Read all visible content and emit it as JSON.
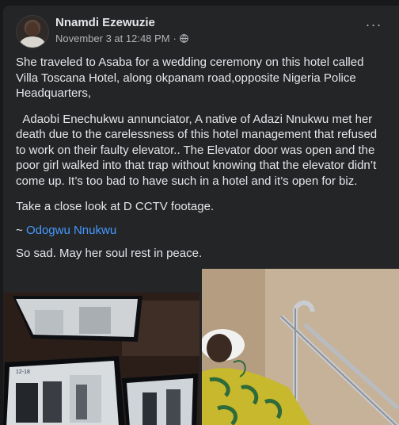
{
  "post": {
    "author": "Nnamdi Ezewuzie",
    "timestamp": "November 3 at 12:48 PM",
    "separator": "·",
    "privacy_icon": "globe-icon",
    "more_icon": "more-options-icon",
    "more_label": "···",
    "paragraphs": {
      "p1": "She traveled to Asaba for a wedding ceremony on this hotel called Villa Toscana Hotel, along okpanam road,opposite Nigeria Police Headquarters,",
      "p2": "  Adaobi Enechukwu annunciator, A native of Adazi Nnukwu met her death due to the carelessness of this hotel management that refused to work on their faulty elevator.. The Elevator door was open and the poor girl walked into that trap without knowing that the elevator didn’t come up. It’s too bad to have such in a hotel and it’s open for biz.",
      "p3": "Take a close look at D CCTV footage.",
      "p4_prefix": "~ ",
      "p4_mention": "Odogwu Nnukwu",
      "p5": "So sad. May her soul rest in peace."
    }
  },
  "colors": {
    "background": "#18191a",
    "card": "#242526",
    "text": "#e4e6eb",
    "secondary_text": "#b0b3b8",
    "link": "#4599ff"
  },
  "media": {
    "left_photo": "cctv-monitor-photo",
    "right_photo": "hospital-bed-photo",
    "monitor_timestamp": "12-18"
  }
}
